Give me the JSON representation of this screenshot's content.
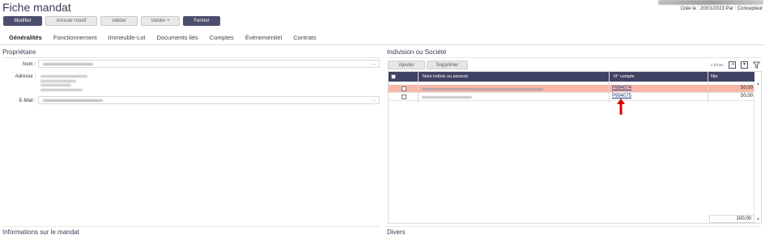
{
  "header": {
    "title": "Fiche mandat",
    "created": "Crée le : 20/01/2023 Par : Concepteur"
  },
  "toolbar": {
    "modifier": "Modifier",
    "annuler": "Annuler modif",
    "valider": "Valider",
    "valider_plus": "Valider +",
    "fermer": "Fermer"
  },
  "tabs": [
    "Généralités",
    "Fonctionnement",
    "Immeuble-Lot",
    "Documents liés",
    "Comptes",
    "Évènementiel",
    "Contrats"
  ],
  "proprietaire": {
    "title": "Propriétaire",
    "nom_label": "Nom :",
    "adresse_label": "Adresse :",
    "email_label": "E-Mail :"
  },
  "indivision": {
    "title": "Indivision ou Société",
    "ajouter": "Ajouter",
    "supprimer": "Supprimer",
    "count": "2 fiches",
    "columns": [
      "Nom indivis ou associé",
      "N° compte",
      "Nbr"
    ],
    "rows": [
      {
        "compte": "P994074",
        "nbr": "50,00"
      },
      {
        "compte": "P994075",
        "nbr": "50,00"
      }
    ],
    "total": "100,00"
  },
  "bottom": {
    "informations": "Informations sur le mandat",
    "divers": "Divers"
  },
  "icons": {
    "export": "export-icon",
    "settings": "grid-settings-icon",
    "filter": "filter-icon",
    "annotation": "red-arrow-annotation"
  },
  "colors": {
    "accent": "#3f4263",
    "selected_row": "#f8b8a8",
    "annotation": "#e00000"
  }
}
